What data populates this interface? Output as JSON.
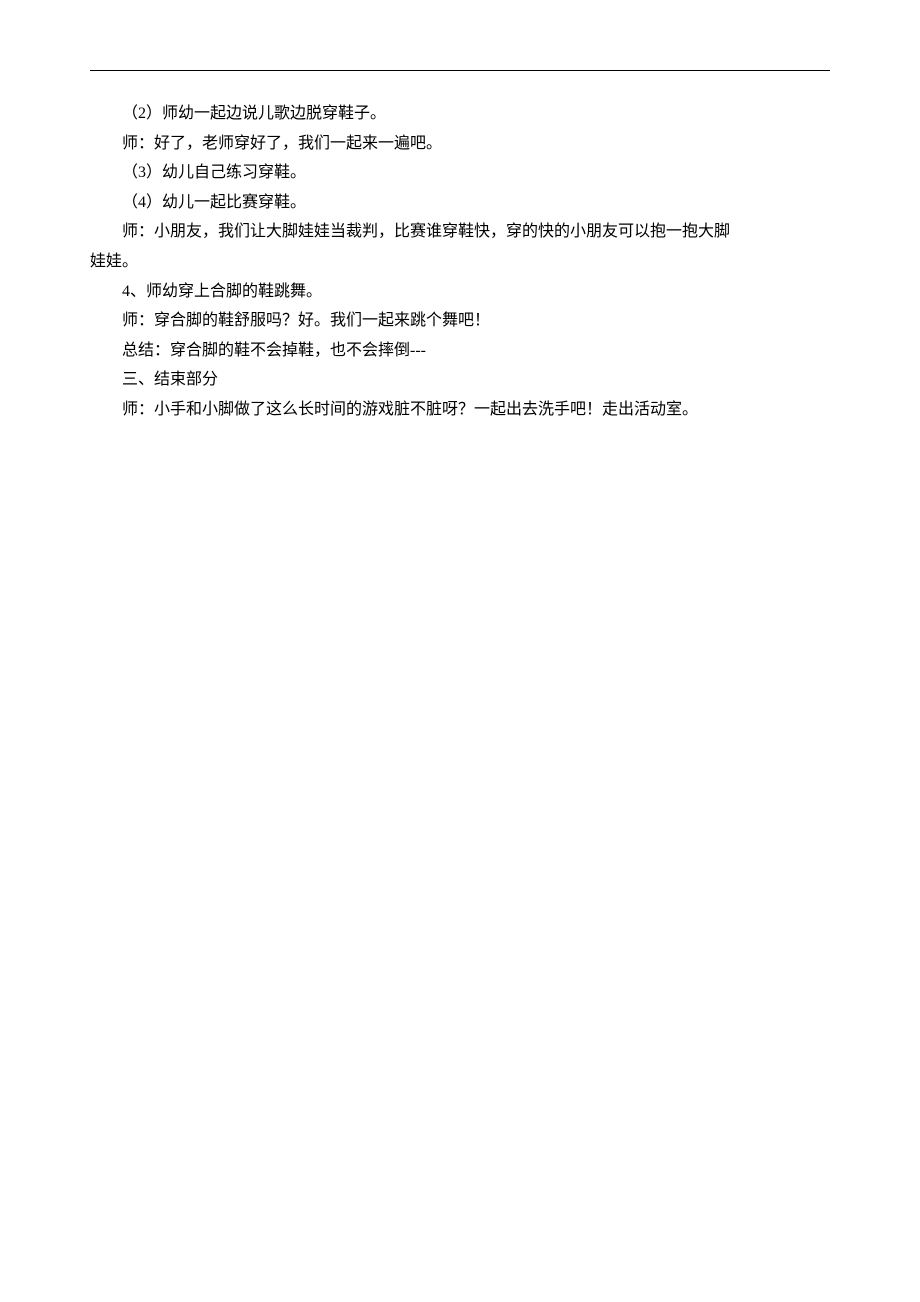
{
  "lines": [
    {
      "text": "（2）师幼一起边说儿歌边脱穿鞋子。",
      "cls": "indent-2"
    },
    {
      "text": "师：好了，老师穿好了，我们一起来一遍吧。",
      "cls": "indent-2"
    },
    {
      "text": "（3）幼儿自己练习穿鞋。",
      "cls": "indent-2"
    },
    {
      "text": "（4）幼儿一起比赛穿鞋。",
      "cls": "indent-2"
    },
    {
      "text": "师：小朋友，我们让大脚娃娃当裁判，比赛谁穿鞋快，穿的快的小朋友可以抱一抱大脚",
      "cls": "indent-2"
    },
    {
      "text": "娃娃。",
      "cls": "no-indent"
    },
    {
      "text": "4、师幼穿上合脚的鞋跳舞。",
      "cls": "indent-2"
    },
    {
      "text": "师：穿合脚的鞋舒服吗？好。我们一起来跳个舞吧！",
      "cls": "indent-2"
    },
    {
      "text": "总结：穿合脚的鞋不会掉鞋，也不会摔倒---",
      "cls": "indent-2"
    },
    {
      "text": "三、结束部分",
      "cls": "indent-2"
    },
    {
      "text": "师：小手和小脚做了这么长时间的游戏脏不脏呀？一起出去洗手吧！走出活动室。",
      "cls": "indent-2"
    }
  ]
}
